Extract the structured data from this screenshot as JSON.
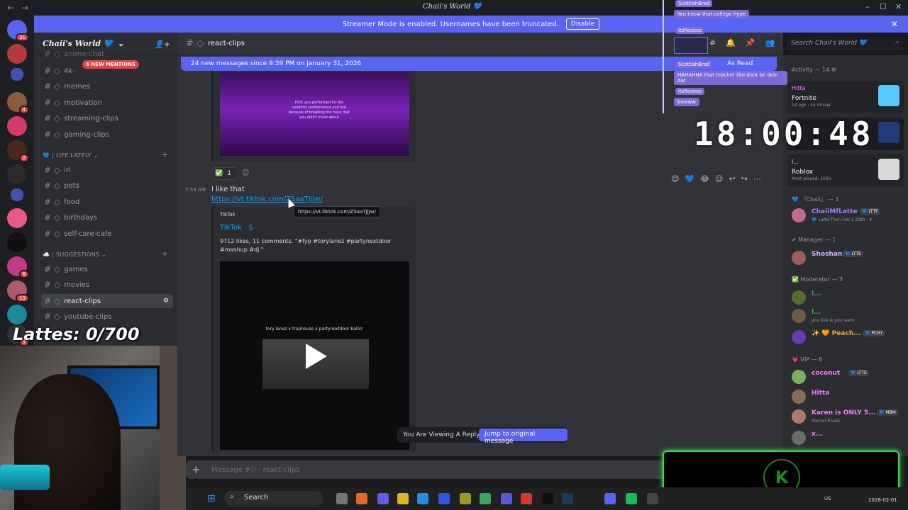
{
  "window": {
    "title": "Chaii's World 💙",
    "back_glyph": "←",
    "forward_glyph": "→",
    "minimize_glyph": "–",
    "maximize_glyph": "☐",
    "close_glyph": "✕"
  },
  "banner": {
    "text": "Streamer Mode is enabled. Usernames have been truncated.",
    "disable_label": "Disable",
    "close_glyph": "✕"
  },
  "server": {
    "name": "Chaii's World 💙",
    "chevron": "⌄",
    "invite_glyph": "👤+",
    "badges": [
      "31",
      "",
      "4",
      "",
      "2",
      "",
      "8",
      "13",
      "",
      "3"
    ]
  },
  "sidebar": {
    "partial_top_label": "anime-chat",
    "mentions_pill": "6 NEW MENTIONS",
    "channels_top": [
      {
        "label": "4k-"
      },
      {
        "label": "memes"
      },
      {
        "label": "motivation"
      },
      {
        "label": "streaming-clips"
      },
      {
        "label": "gaming-clips"
      }
    ],
    "category_life": "💙 | LIFE LATELY ⌄",
    "channels_life": [
      {
        "label": "irl"
      },
      {
        "label": "pets"
      },
      {
        "label": "food"
      },
      {
        "label": "birthdays"
      },
      {
        "label": "self-care-cafe"
      }
    ],
    "category_suggestions": "☁️ | SUGGESTIONS ⌄",
    "channels_suggestions": [
      {
        "label": "games"
      },
      {
        "label": "movies"
      },
      {
        "label": "react-clips"
      },
      {
        "label": "youtube-clips"
      }
    ],
    "plus_glyph": "+",
    "hash_glyph": "# ◇"
  },
  "stream_overlay": {
    "lattes_counter": "Lattes: 0/700",
    "clock": "18:00:48",
    "chat": [
      {
        "user": "ScottishBrod",
        "message": "You know that college hype"
      },
      {
        "user": "itzRosexo",
        "message": ""
      },
      {
        "user": "ScottishBrod",
        "message": "HAHAHHA that teacher like dont be doin dat"
      },
      {
        "user": "itzRosexo",
        "message": "bowww"
      }
    ],
    "kick_glyph": "K"
  },
  "chat": {
    "channel": "react-clips",
    "search_placeholder": "Search Chaii's World 💙",
    "search_icon": "⌕",
    "header_icons": [
      "#",
      "🔔",
      "📌",
      "👥"
    ],
    "new_messages_banner": "24 new messages since 9:39 PM on January 31, 2026",
    "mark_as_read": "As Read",
    "top_embed_caption": "POV: you performed for the celebrity performance and lost because of breaking the rules that you didn't know about",
    "reaction": {
      "emoji": "✅",
      "count": "1"
    },
    "add_reaction_glyph": "☺",
    "message_toolbar": [
      "😊",
      "💙",
      "😂",
      "☺",
      "↩",
      "↪",
      "⋯"
    ],
    "message": {
      "timestamp": "7:53 AM",
      "text": "I like that",
      "link": "https://vt.tiktok.com/ZSaaTJjJw/",
      "tooltip": "https://vt.tiktok.com/ZSaaTJjJw/"
    },
    "embed": {
      "provider": "TikTok",
      "title": "TikTok · S",
      "description": "9712 likes, 11 comments. \"#fyp #torylanez #partynextdoor #mashup #dj \"",
      "video_overlay_text": "tory lanez x traphouse x partynextdoor ballin'"
    },
    "reply_bar": {
      "text": "You Are Viewing A Reply.",
      "jump_label": "Jump to original message"
    },
    "composer_placeholder": "Message #◇ · react-clips",
    "composer_plus": "+"
  },
  "members": {
    "activity_header": "Activity — 14 ⚙",
    "activities": [
      {
        "user": "Hitta",
        "game": "Fortnite",
        "detail": "1d ago · 4x Streak",
        "tile_color": "#5ac8fa"
      },
      {
        "user": "",
        "game": "",
        "detail": "",
        "tile_color": "#243a7a"
      },
      {
        "user": "l...",
        "game": "Roblox",
        "detail": "Most played: 102h",
        "tile_color": "#d9d9d9"
      }
    ],
    "groups": [
      {
        "header": "💙 『Chaii』 — 1",
        "rows": [
          {
            "name": "ChaiiMfLatte",
            "tag": "💙 LTTE",
            "sub": "💙 Latte-Thon Feb 1-29th - K",
            "color": "#9b84ff"
          }
        ]
      },
      {
        "header": "✔ Manager — 1",
        "rows": [
          {
            "name": "Shoshana",
            "tag": "💙 LTTE",
            "sub": "",
            "color": "#c9b8ff"
          }
        ]
      },
      {
        "header": "✅ Moderator — 3",
        "rows": [
          {
            "name": "l...",
            "tag": "",
            "sub": "",
            "color": "#3ba55d"
          },
          {
            "name": "l...",
            "tag": "",
            "sub": "you live & you learn",
            "color": "#3ba55d"
          },
          {
            "name": "✨ 🧡 Peach...",
            "tag": "💙 PCHY",
            "sub": "",
            "color": "#e6a93a"
          }
        ]
      },
      {
        "header": "💗 VIP — 6",
        "rows": [
          {
            "name": "coconut",
            "tag": "💙 LTTE",
            "sub": "",
            "color": "#f47fff"
          },
          {
            "name": "Hitta",
            "tag": "",
            "sub": "",
            "color": "#f47fff"
          },
          {
            "name": "Karen is ONLY 5...",
            "tag": "💙 MBM",
            "sub": "Marvel Rivals",
            "color": "#f47fff"
          },
          {
            "name": "x...",
            "tag": "",
            "sub": "",
            "color": "#f47fff"
          }
        ]
      }
    ]
  },
  "taskbar": {
    "search_label": "Search",
    "search_icon": "⌕",
    "windows_glyph": "⊞",
    "tray": "US",
    "date": "2026-02-01"
  }
}
